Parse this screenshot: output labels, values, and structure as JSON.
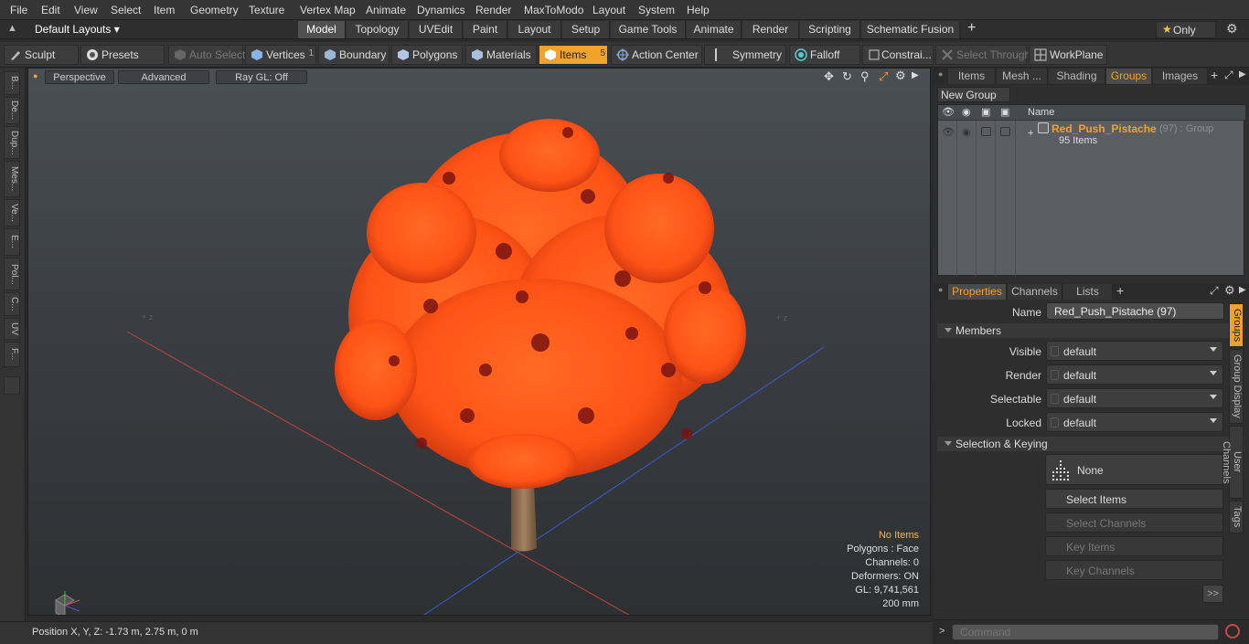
{
  "menu": [
    "File",
    "Edit",
    "View",
    "Select",
    "Item",
    "Geometry",
    "Texture",
    "Vertex Map",
    "Animate",
    "Dynamics",
    "Render",
    "MaxToModo",
    "Layout",
    "System",
    "Help"
  ],
  "layout_selector": "Default Layouts",
  "mode_tabs": [
    "Model",
    "Topology",
    "UVEdit",
    "Paint",
    "Layout",
    "Setup",
    "Game Tools",
    "Animate",
    "Render",
    "Scripting",
    "Schematic Fusion"
  ],
  "add_tab": "+",
  "only_label": "Only",
  "toolbar": {
    "sculpt": "Sculpt",
    "presets": "Presets",
    "auto_select": "Auto Select",
    "vertices": "Vertices",
    "vertices_count": "1",
    "boundary": "Boundary",
    "polygons": "Polygons",
    "materials": "Materials",
    "items": "Items",
    "items_count": "5",
    "action_center": "Action Center",
    "symmetry": "Symmetry",
    "falloff": "Falloff",
    "constraints": "Constrai...",
    "select_through": "Select Through",
    "workplane": "WorkPlane"
  },
  "left_tools": [
    "B...",
    "De...",
    "Dup...",
    "Mes...",
    "Ve...",
    "E...",
    "Pol...",
    "C...",
    "UV",
    "F..."
  ],
  "viewport": {
    "view": "Perspective",
    "advanced": "Advanced",
    "raygl": "Ray GL: Off",
    "hud": {
      "items": "No Items",
      "polygons": "Polygons : Face",
      "channels": "Channels: 0",
      "deformers": "Deformers: ON",
      "gl": "GL: 9,741,561",
      "scale": "200 mm"
    },
    "accent": "#f2a12a",
    "foliage": "#ff5a1a"
  },
  "status": {
    "position": "Position X, Y, Z:  -1.73 m, 2.75 m, 0 m"
  },
  "panel_tabs": [
    "Items",
    "Mesh ...",
    "Shading",
    "Groups",
    "Images"
  ],
  "groups": {
    "new_group": "New Group",
    "col_name": "Name",
    "item_name": "Red_Push_Pistache",
    "item_suffix": "(97) : Group",
    "item_sub": "95 Items"
  },
  "props_tabs": [
    "Properties",
    "Channels",
    "Lists"
  ],
  "props": {
    "name_label": "Name",
    "name_value": "Red_Push_Pistache  (97)",
    "members": "Members",
    "visible_label": "Visible",
    "visible": "default",
    "render_label": "Render",
    "render": "default",
    "selectable_label": "Selectable",
    "selectable": "default",
    "locked_label": "Locked",
    "locked": "default",
    "sel_keying": "Selection & Keying",
    "none": "None",
    "select_items": "Select Items",
    "select_channels": "Select Channels",
    "key_items": "Key Items",
    "key_channels": "Key Channels",
    "more": ">>"
  },
  "side_tabs": [
    "Groups",
    "Group Display",
    "User Channels",
    "Tags"
  ],
  "command_placeholder": "Command"
}
